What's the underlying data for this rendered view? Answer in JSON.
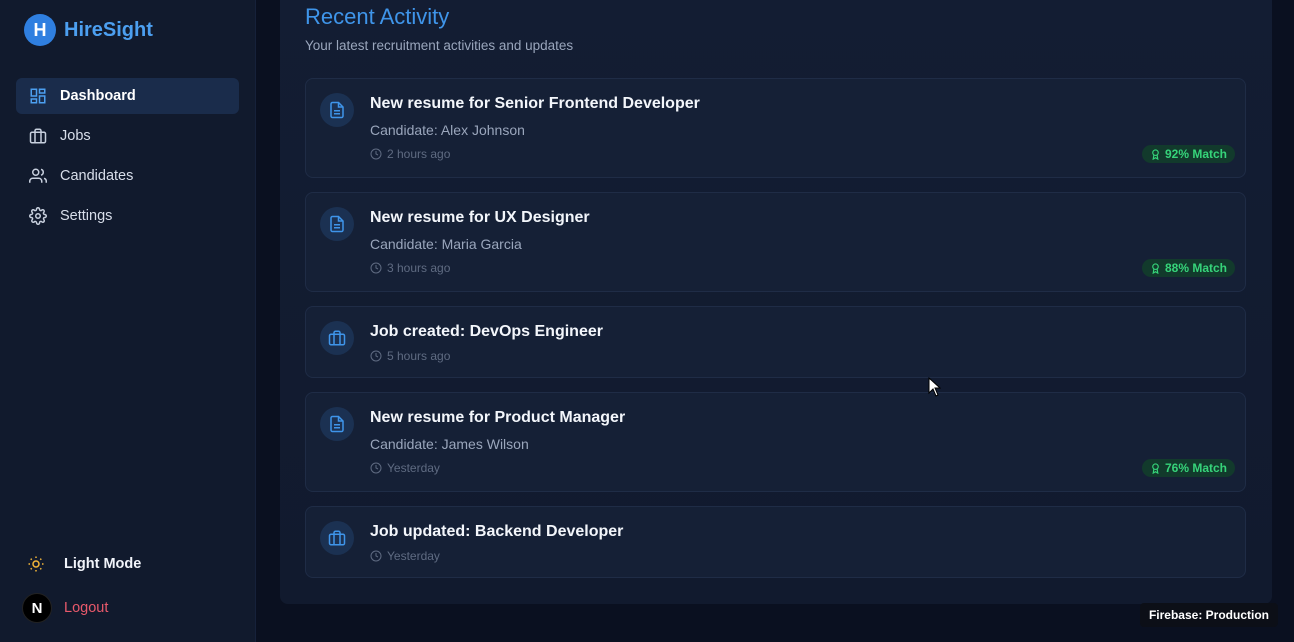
{
  "brand": {
    "logo_letter": "H",
    "name": "HireSight"
  },
  "nav": {
    "items": [
      {
        "label": "Dashboard",
        "icon": "dashboard-icon",
        "active": true
      },
      {
        "label": "Jobs",
        "icon": "briefcase-icon",
        "active": false
      },
      {
        "label": "Candidates",
        "icon": "users-icon",
        "active": false
      },
      {
        "label": "Settings",
        "icon": "gear-icon",
        "active": false
      }
    ]
  },
  "sidebar_bottom": {
    "mode_label": "Light Mode",
    "mode_icon": "sun-icon",
    "avatar_letter": "N",
    "logout_label": "Logout"
  },
  "recent_activity": {
    "title": "Recent Activity",
    "subtitle": "Your latest recruitment activities and updates",
    "items": [
      {
        "type": "resume",
        "icon": "document-icon",
        "title": "New resume for Senior Frontend Developer",
        "candidate": "Candidate: Alex Johnson",
        "time": "2 hours ago",
        "match": "92% Match"
      },
      {
        "type": "resume",
        "icon": "document-icon",
        "title": "New resume for UX Designer",
        "candidate": "Candidate: Maria Garcia",
        "time": "3 hours ago",
        "match": "88% Match"
      },
      {
        "type": "job",
        "icon": "briefcase-icon",
        "title": "Job created: DevOps Engineer",
        "time": "5 hours ago"
      },
      {
        "type": "resume",
        "icon": "document-icon",
        "title": "New resume for Product Manager",
        "candidate": "Candidate: James Wilson",
        "time": "Yesterday",
        "match": "76% Match"
      },
      {
        "type": "job",
        "icon": "briefcase-icon",
        "title": "Job updated: Backend Developer",
        "time": "Yesterday"
      }
    ]
  },
  "env_badge": "Firebase: Production",
  "colors": {
    "accent": "#3f95ea",
    "match_green": "#36d47a",
    "logout_red": "#e8596b",
    "sidebar_bg": "#111a2d",
    "panel_bg": "#131d33"
  }
}
